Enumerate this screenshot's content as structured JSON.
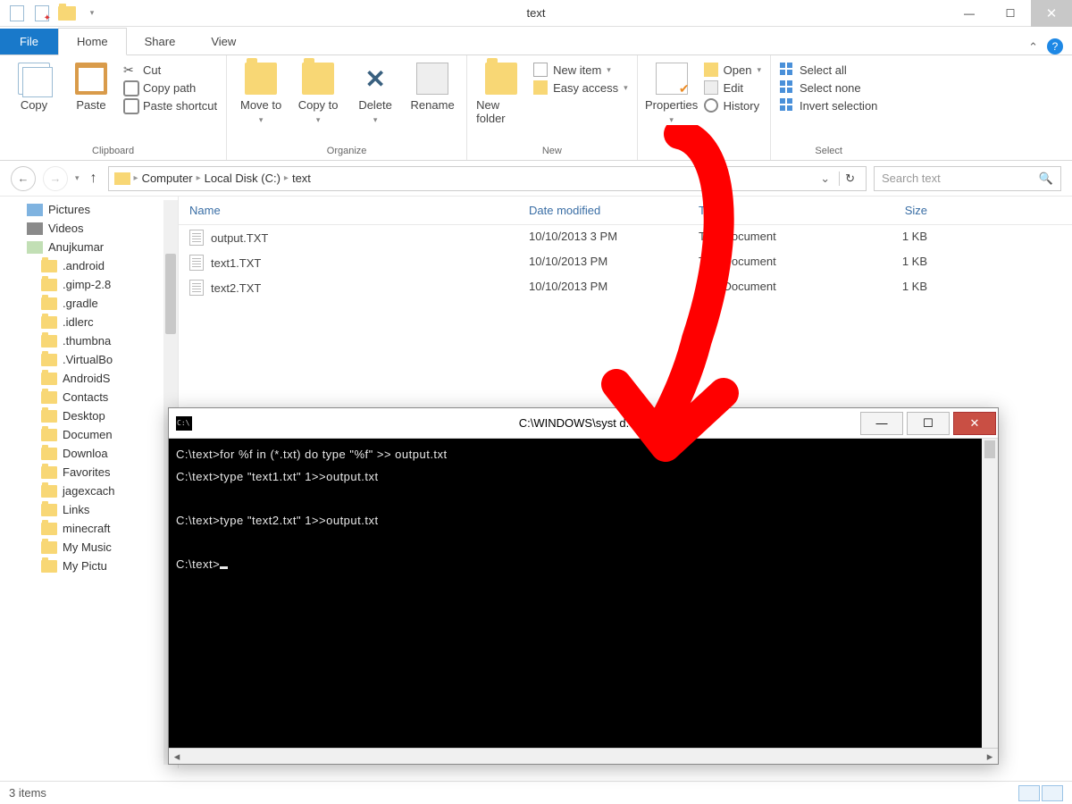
{
  "window": {
    "title": "text"
  },
  "winbtns": {
    "min": "—",
    "max": "☐",
    "close": "✕"
  },
  "tabs": {
    "file": "File",
    "home": "Home",
    "share": "Share",
    "view": "View",
    "help": "?",
    "chev": "⌃"
  },
  "ribbon": {
    "clipboard": {
      "label": "Clipboard",
      "copy": "Copy",
      "paste": "Paste",
      "cut": "Cut",
      "copypath": "Copy path",
      "shortcut": "Paste shortcut"
    },
    "organize": {
      "label": "Organize",
      "moveto": "Move to",
      "copyto": "Copy to",
      "delete": "Delete",
      "rename": "Rename"
    },
    "new": {
      "label": "New",
      "newfolder": "New folder",
      "newitem": "New item",
      "easyaccess": "Easy access"
    },
    "open": {
      "label": "Open",
      "properties": "Properties",
      "open": "Open",
      "edit": "Edit",
      "history": "History"
    },
    "select": {
      "label": "Select",
      "all": "Select all",
      "none": "Select none",
      "invert": "Invert selection"
    }
  },
  "breadcrumb": {
    "root": "Computer",
    "drive": "Local Disk (C:)",
    "folder": "text"
  },
  "search": {
    "placeholder": "Search text"
  },
  "cols": {
    "name": "Name",
    "date": "Date modified",
    "type": "Type",
    "size": "Size"
  },
  "tree": {
    "items": [
      {
        "label": "Pictures",
        "k": "pic"
      },
      {
        "label": "Videos",
        "k": "vic"
      },
      {
        "label": "Anujkumar",
        "k": "uic"
      },
      {
        "label": ".android",
        "k": "fic",
        "l": 1
      },
      {
        "label": ".gimp-2.8",
        "k": "fic",
        "l": 1
      },
      {
        "label": ".gradle",
        "k": "fic",
        "l": 1
      },
      {
        "label": ".idlerc",
        "k": "fic",
        "l": 1
      },
      {
        "label": ".thumbna",
        "k": "fic",
        "l": 1
      },
      {
        "label": ".VirtualBo",
        "k": "fic",
        "l": 1
      },
      {
        "label": "AndroidS",
        "k": "fic",
        "l": 1
      },
      {
        "label": "Contacts",
        "k": "fic",
        "l": 1
      },
      {
        "label": "Desktop",
        "k": "fic",
        "l": 1
      },
      {
        "label": "Documen",
        "k": "fic",
        "l": 1
      },
      {
        "label": "Downloa",
        "k": "fic",
        "l": 1
      },
      {
        "label": "Favorites",
        "k": "fic",
        "l": 1
      },
      {
        "label": "jagexcach",
        "k": "fic",
        "l": 1
      },
      {
        "label": "Links",
        "k": "fic",
        "l": 1
      },
      {
        "label": "minecraft",
        "k": "fic",
        "l": 1
      },
      {
        "label": "My Music",
        "k": "fic",
        "l": 1
      },
      {
        "label": "My Pictu",
        "k": "fic",
        "l": 1
      }
    ]
  },
  "files": [
    {
      "name": "output.TXT",
      "date": "10/10/2013 3     PM",
      "type": "Text Document",
      "size": "1 KB"
    },
    {
      "name": "text1.TXT",
      "date": "10/10/2013        PM",
      "type": "Text Document",
      "size": "1 KB"
    },
    {
      "name": "text2.TXT",
      "date": "10/10/2013        PM",
      "type": "Text Document",
      "size": "1 KB"
    }
  ],
  "status": {
    "count": "3 items"
  },
  "cmd": {
    "title": "C:\\WINDOWS\\syst            d.exe",
    "lines": [
      "C:\\text>for %f in (*.txt) do type \"%f\" >> output.txt",
      "C:\\text>type \"text1.txt\"  1>>output.txt",
      "C:\\text>type \"text2.txt\"  1>>output.txt",
      "C:\\text>"
    ]
  }
}
